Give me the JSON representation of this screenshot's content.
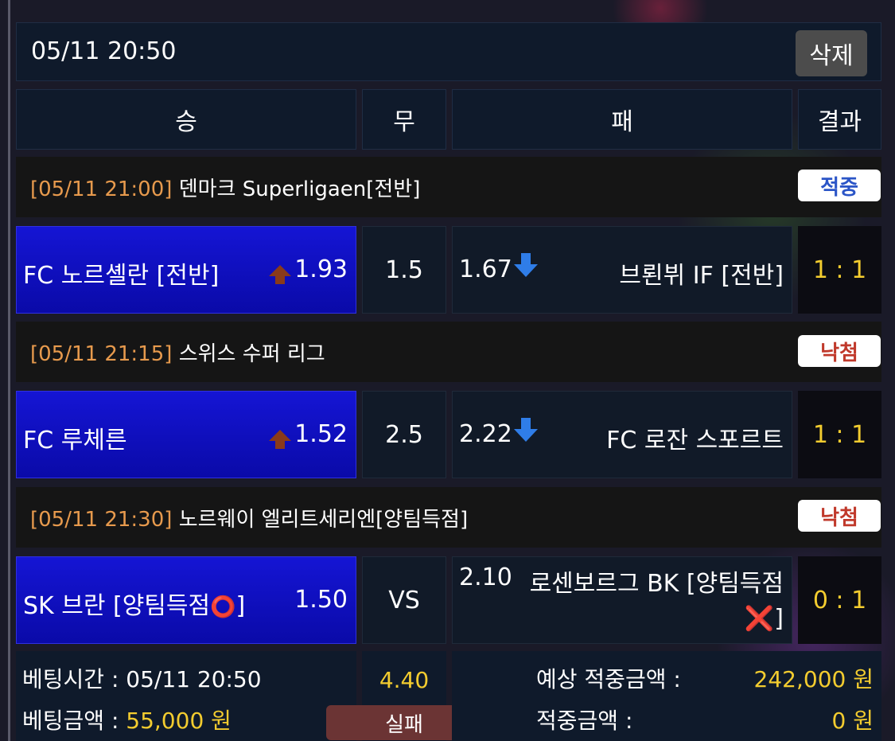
{
  "header": {
    "datetime": "05/11 20:50",
    "delete_label": "삭제"
  },
  "columns": {
    "win": "승",
    "draw": "무",
    "lose": "패",
    "result": "결과"
  },
  "matches": [
    {
      "time": "[05/11 21:00]",
      "league": "덴마크 Superligaen[전반]",
      "badge": "적중",
      "home": "FC 노르셸란 [전반]",
      "home_odds": "1.93",
      "draw": "1.5",
      "away_odds": "1.67",
      "away": "브뢴뷔 IF [전반]",
      "score": "1 : 1"
    },
    {
      "time": "[05/11 21:15]",
      "league": "스위스 수퍼 리그",
      "badge": "낙첨",
      "home": "FC 루체른",
      "home_odds": "1.52",
      "draw": "2.5",
      "away_odds": "2.22",
      "away": "FC 로잔 스포르트",
      "score": "1 : 1"
    },
    {
      "time": "[05/11 21:30]",
      "league": "노르웨이 엘리트세리엔[양팀득점]",
      "badge": "낙첨",
      "home": "SK 브란 [양팀득점",
      "home_mark": "⭕",
      "home_close": "]",
      "home_odds": "1.50",
      "draw": "VS",
      "away_odds": "2.10",
      "away": "로센보르그 BK [양팀득점",
      "away_mark": "❌",
      "away_close": "]",
      "score": "0 : 1"
    }
  ],
  "summary": {
    "bet_time_label": "베팅시간 : ",
    "bet_time": "05/11 20:50",
    "bet_amount_label": "베팅금액 : ",
    "bet_amount": "55,000 원",
    "total_odds": "4.40",
    "status": "실패",
    "expected_label": "예상 적중금액 :",
    "expected": "242,000 원",
    "won_label": "적중금액 :",
    "won": "0 원"
  }
}
